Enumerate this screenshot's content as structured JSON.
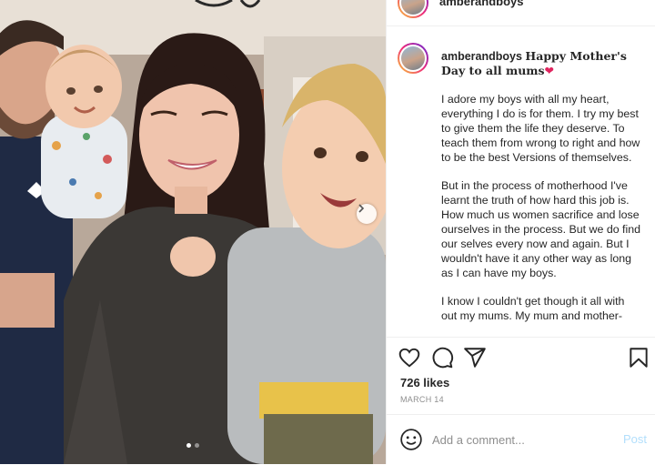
{
  "post": {
    "username": "amberandboys",
    "more_label": "•••",
    "photo_alt": "Family photo",
    "carousel": {
      "current": 1,
      "total": 2
    }
  },
  "caption": {
    "username": "amberandboys",
    "title": "Happy Mother's Day to all mums",
    "title_emoji": "❤",
    "paragraphs": [
      "I adore my boys with all my heart, everything I do is for them. I try my best to give them the life they deserve. To teach them from wrong to right and how to be the best Versions of themselves.",
      "But in the process of motherhood I've learnt the truth of how hard this job is. How much us women sacrifice and lose ourselves in the process. But we do find our selves every now and again. But I wouldn't have it any other way as long as I can have my boys.",
      "I know I couldn't get though it all with out my mums. My mum and mother-"
    ]
  },
  "actions": {
    "icons": [
      "heart-icon",
      "comment-icon",
      "share-icon",
      "bookmark-icon"
    ],
    "likes": "726 likes",
    "date": "MARCH 14"
  },
  "comment_box": {
    "placeholder": "Add a comment...",
    "post_label": "Post"
  },
  "colors": {
    "post_button": "#b2dffc",
    "meta_gray": "#8e8e8e",
    "text": "#262626"
  }
}
